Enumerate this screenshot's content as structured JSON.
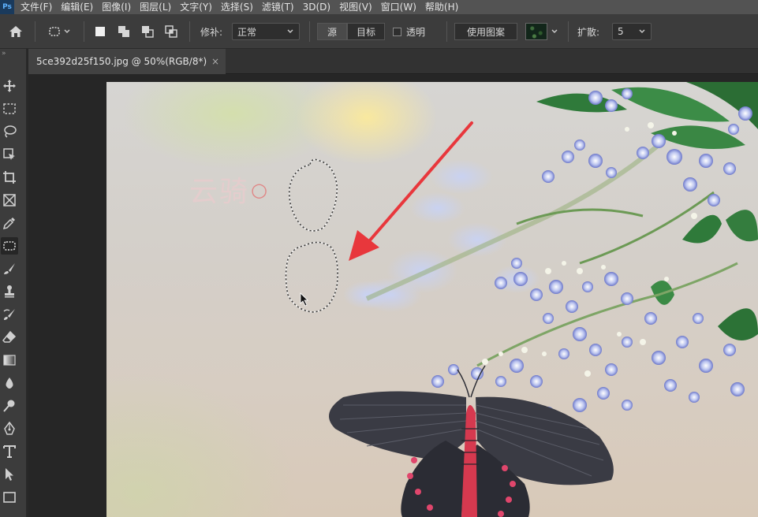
{
  "menubar": {
    "logo": "Ps",
    "items": [
      "文件(F)",
      "编辑(E)",
      "图像(I)",
      "图层(L)",
      "文字(Y)",
      "选择(S)",
      "滤镜(T)",
      "3D(D)",
      "视图(V)",
      "窗口(W)",
      "帮助(H)"
    ]
  },
  "options": {
    "patch_label": "修补:",
    "patch_value": "正常",
    "source_label": "源",
    "dest_label": "目标",
    "transparent_label": "透明",
    "use_pattern_label": "使用图案",
    "diffusion_label": "扩散:",
    "diffusion_value": "5"
  },
  "document": {
    "tab_title": "5ce392d25f150.jpg @ 50%(RGB/8*)",
    "close_glyph": "×"
  },
  "canvas": {
    "watermark_text": "云骑",
    "watermark_mark": "○"
  },
  "tools": [
    "move-tool",
    "marquee-tool",
    "lasso-tool",
    "object-select-tool",
    "crop-tool",
    "frame-tool",
    "eyedropper-tool",
    "patch-tool",
    "brush-tool",
    "stamp-tool",
    "history-brush-tool",
    "eraser-tool",
    "gradient-tool",
    "blur-tool",
    "dodge-tool",
    "pen-tool",
    "type-tool",
    "path-select-tool",
    "rectangle-tool"
  ],
  "colors": {
    "menubar_bg": "#535353",
    "panel_bg": "#3c3c3c",
    "workspace_bg": "#262626",
    "annotation_arrow": "#e8373c"
  }
}
